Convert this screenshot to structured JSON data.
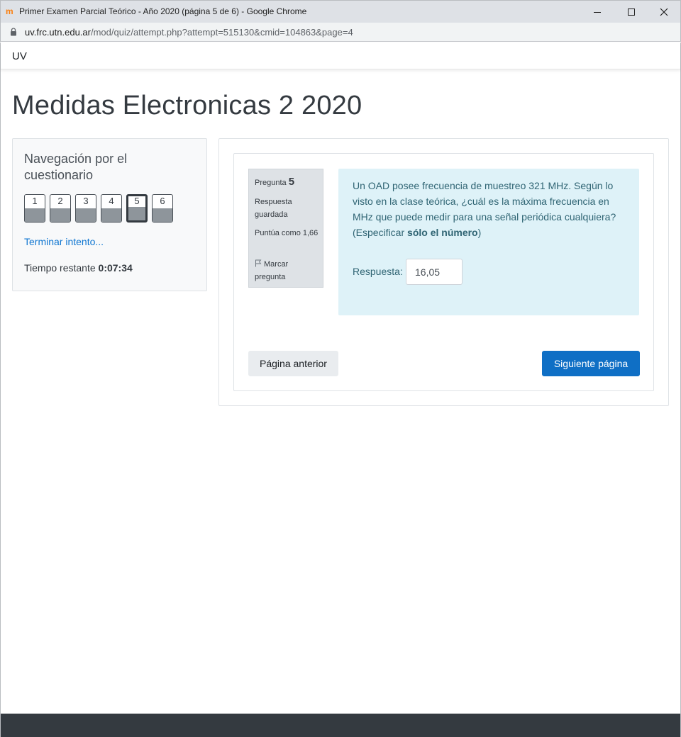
{
  "window": {
    "title": "Primer Examen Parcial Teórico - Año 2020 (página 5 de 6) - Google Chrome",
    "favicon": "moodle-icon"
  },
  "address_bar": {
    "host": "uv.frc.utn.edu.ar",
    "path": "/mod/quiz/attempt.php?attempt=515130&cmid=104863&page=4"
  },
  "navbar": {
    "brand": "UV"
  },
  "course": {
    "title": "Medidas Electronicas 2 2020"
  },
  "quiz_navigation": {
    "title": "Navegación por el cuestionario",
    "questions": [
      {
        "label": "1",
        "current": false
      },
      {
        "label": "2",
        "current": false
      },
      {
        "label": "3",
        "current": false
      },
      {
        "label": "4",
        "current": false
      },
      {
        "label": "5",
        "current": true
      },
      {
        "label": "6",
        "current": false
      }
    ],
    "finish_link": "Terminar intento...",
    "timer_label": "Tiempo restante",
    "timer_value": "0:07:34"
  },
  "question": {
    "number_label": "Pregunta",
    "number": "5",
    "state": "Respuesta guardada",
    "grade": "Puntúa como 1,66",
    "flag_label": "Marcar pregunta",
    "text_before": "Un OAD posee frecuencia de muestreo 321 MHz. Según lo visto en la clase teórica, ¿cuál es la máxima frecuencia en MHz que puede medir para una señal periódica cualquiera? (Especificar ",
    "text_bold": "sólo el número",
    "text_after": ")",
    "answer_label": "Respuesta:",
    "answer_value": "16,05"
  },
  "buttons": {
    "previous": "Página anterior",
    "next": "Siguiente página"
  },
  "colors": {
    "primary": "#0f6fc5",
    "link": "#1177d1",
    "question_bg": "#def2f8",
    "question_text": "#2f6473",
    "footer": "#343a40"
  }
}
